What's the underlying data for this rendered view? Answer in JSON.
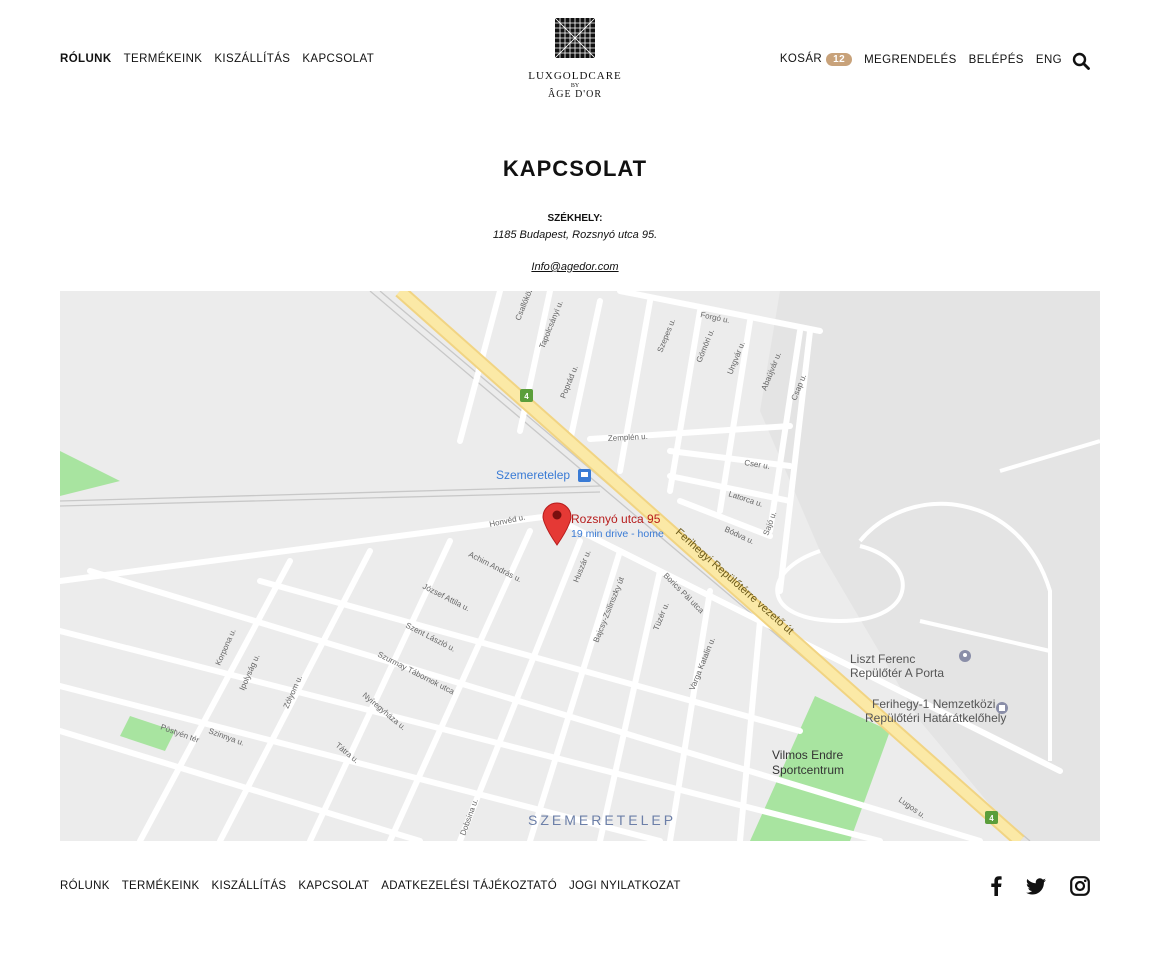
{
  "header": {
    "nav_left": [
      "RÓLUNK",
      "TERMÉKEINK",
      "KISZÁLLÍTÁS",
      "KAPCSOLAT"
    ],
    "cart_label": "KOSÁR",
    "cart_count": "12",
    "order_label": "MEGRENDELÉS",
    "login_label": "BELÉPÉS",
    "lang_label": "ENG",
    "logo": {
      "name": "LUXGOLDCARE",
      "by": "BY",
      "brand": "ÂGE D'OR"
    }
  },
  "main": {
    "title": "KAPCSOLAT",
    "hq_label": "SZÉKHELY:",
    "hq_address": "1185 Budapest, Rozsnyó utca 95.",
    "email": "Info@agedor.com"
  },
  "map": {
    "marker_title": "Rozsnyó utca 95",
    "marker_sub": "19 min drive - home",
    "station": "Szemeretelep",
    "district": "SZEMERETELEP",
    "highway": "Ferihegyi Repülőtérre vezető út",
    "route_number": "4",
    "places": [
      "Liszt Ferenc",
      "Repülőtér A Porta",
      "Ferihegy-1 Nemzetközi",
      "Repülőtéri Határátkelőhely",
      "Vilmos Endre",
      "Sportcentrum"
    ],
    "streets": [
      "Forgó u.",
      "Honvéd u.",
      "Achim András u.",
      "József Attila u.",
      "Szent László u.",
      "Bajcsy-Zsilinszky út",
      "Borics Pál utca",
      "Szurmay Tábornok utca",
      "Zemplén u.",
      "Cser u.",
      "Latorca u.",
      "Bódva u.",
      "Sajó u.",
      "Korpona u.",
      "Nyíregyháza u.",
      "Pöstyén tér",
      "Tátra u.",
      "Dobsina u.",
      "Varga Katalin u.",
      "Lugos u.",
      "Huszár u.",
      "Tüzér u.",
      "Poprád u.",
      "Tapolcsányi u.",
      "Csallóközi u.",
      "Szepes u.",
      "Gömöri u.",
      "Ungvár u.",
      "Abaújvár u.",
      "Csap u.",
      "Zólyom u.",
      "Szinnya u.",
      "Ipolyság u."
    ],
    "colors": {
      "land": "#ececec",
      "road": "#ffffff",
      "highway": "#fbe9a6",
      "park": "#a8e4a0",
      "marker": "#e53935",
      "label_blue": "#3a7bd5"
    }
  },
  "footer": {
    "nav": [
      "RÓLUNK",
      "TERMÉKEINK",
      "KISZÁLLÍTÁS",
      "KAPCSOLAT",
      "ADATKEZELÉSI TÁJÉKOZTATÓ",
      "JOGI NYILATKOZAT"
    ],
    "social": [
      "facebook-icon",
      "twitter-icon",
      "instagram-icon"
    ]
  }
}
